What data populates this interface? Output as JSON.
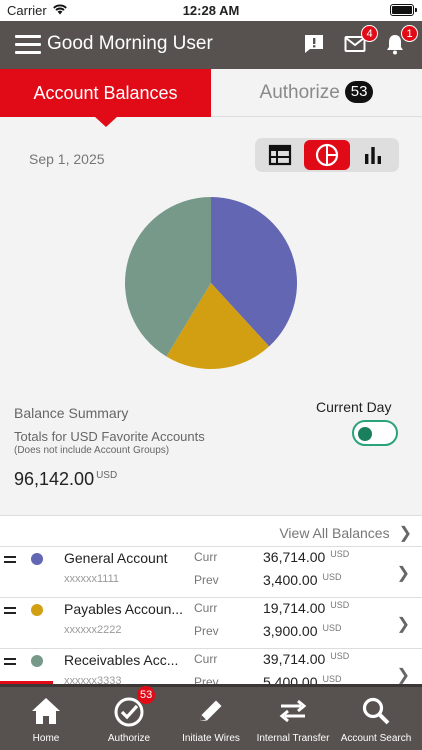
{
  "status_bar": {
    "carrier": "Carrier",
    "time": "12:28 AM"
  },
  "header": {
    "title": "Good Morning User",
    "messages_badge": "4",
    "notifications_badge": "1"
  },
  "tabs": {
    "account_balances": "Account Balances",
    "authorize": "Authorize",
    "authorize_count": "53"
  },
  "date": "Sep 1, 2025",
  "view_toggle": {
    "selected": "pie-chart"
  },
  "chart_data": {
    "type": "pie",
    "slices": [
      {
        "label": "General Account",
        "value": 36714.0,
        "color": "#6366b3"
      },
      {
        "label": "Payables Account",
        "value": 19714.0,
        "color": "#d29f12"
      },
      {
        "label": "Receivables Account",
        "value": 39714.0,
        "color": "#76998a"
      }
    ]
  },
  "summary": {
    "title": "Balance Summary",
    "subtitle": "Totals for USD Favorite Accounts",
    "note": "(Does not include Account Groups)",
    "total": "96,142.00",
    "currency": "USD",
    "current_day_label": "Current Day"
  },
  "list": {
    "view_all": "View All Balances",
    "accounts": [
      {
        "name": "General Account",
        "number": "xxxxxx1111",
        "curr_label": "Curr",
        "prev_label": "Prev",
        "curr_amount": "36,714.00",
        "prev_amount": "3,400.00",
        "currency": "USD",
        "color": "#6366b3"
      },
      {
        "name": "Payables Accoun...",
        "number": "xxxxxx2222",
        "curr_label": "Curr",
        "prev_label": "Prev",
        "curr_amount": "19,714.00",
        "prev_amount": "3,900.00",
        "currency": "USD",
        "color": "#d29f12"
      },
      {
        "name": "Receivables Acc...",
        "number": "xxxxxx3333",
        "curr_label": "Curr",
        "prev_label": "Prev",
        "curr_amount": "39,714.00",
        "prev_amount": "5,400.00",
        "currency": "USD",
        "color": "#76998a"
      }
    ]
  },
  "bottom_nav": [
    {
      "label": "Home",
      "icon": "home-icon"
    },
    {
      "label": "Authorize",
      "icon": "check-circle-icon",
      "badge": "53"
    },
    {
      "label": "Initiate Wires",
      "icon": "pencil-icon"
    },
    {
      "label": "Internal Transfer",
      "icon": "transfer-arrows-icon"
    },
    {
      "label": "Account Search",
      "icon": "search-icon"
    }
  ]
}
